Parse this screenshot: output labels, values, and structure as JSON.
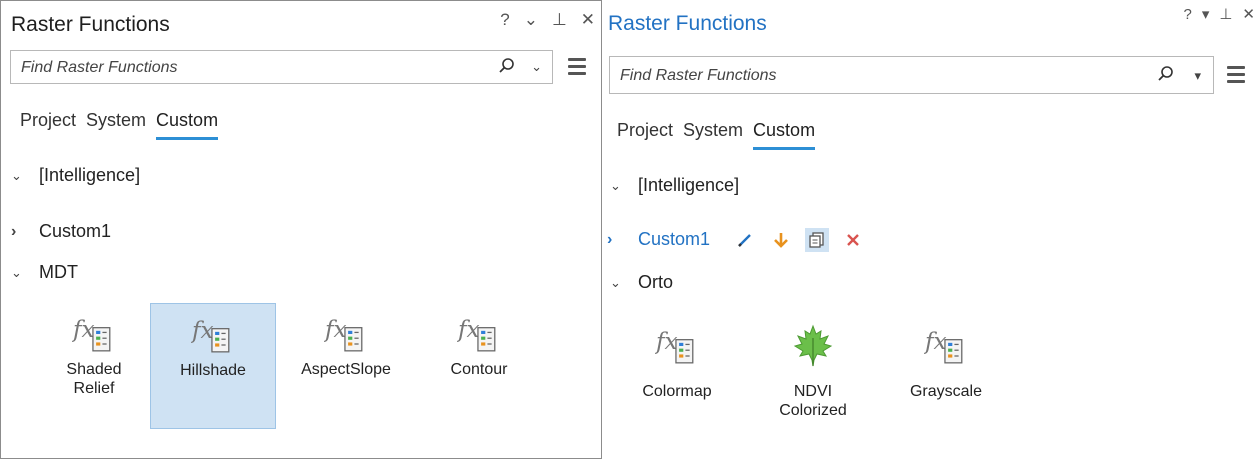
{
  "left": {
    "title": "Raster Functions",
    "window_buttons": [
      "?",
      "⌄",
      "⊥",
      "✕"
    ],
    "search_placeholder": "Find Raster Functions",
    "tabs": [
      "Project",
      "System",
      "Custom"
    ],
    "groups": [
      {
        "label": "[Intelligence]",
        "expanded": true
      },
      {
        "label": "Custom1",
        "expanded": false
      },
      {
        "label": "MDT",
        "expanded": true
      }
    ],
    "tiles": [
      {
        "label": "Shaded\nRelief",
        "icon": "fx-function-icon",
        "selected": false
      },
      {
        "label": "Hillshade",
        "icon": "fx-function-icon",
        "selected": true
      },
      {
        "label": "AspectSlope",
        "icon": "fx-function-icon",
        "selected": false
      },
      {
        "label": "Contour",
        "icon": "fx-function-icon",
        "selected": false
      }
    ]
  },
  "right": {
    "title": "Raster Functions",
    "window_buttons": [
      "?",
      "▾",
      "⊥",
      "✕"
    ],
    "search_placeholder": "Find Raster Functions",
    "tabs": [
      "Project",
      "System",
      "Custom"
    ],
    "groups": [
      {
        "label": "[Intelligence]",
        "expanded": true
      },
      {
        "label": "Custom1",
        "expanded": false,
        "highlighted": true
      },
      {
        "label": "Orto",
        "expanded": true
      }
    ],
    "custom1_actions": [
      "pencil-icon",
      "download-arrow-icon",
      "copy-icon",
      "delete-icon"
    ],
    "tiles": [
      {
        "label": "Colormap",
        "icon": "fx-function-icon"
      },
      {
        "label": "NDVI\nColorized",
        "icon": "leaf-icon"
      },
      {
        "label": "Grayscale",
        "icon": "fx-function-icon"
      }
    ]
  },
  "colors": {
    "accent": "#2d8fd5",
    "title_blue": "#2272c3",
    "selection": "#cfe2f3",
    "orange": "#e8921e",
    "red": "#d9534f"
  }
}
